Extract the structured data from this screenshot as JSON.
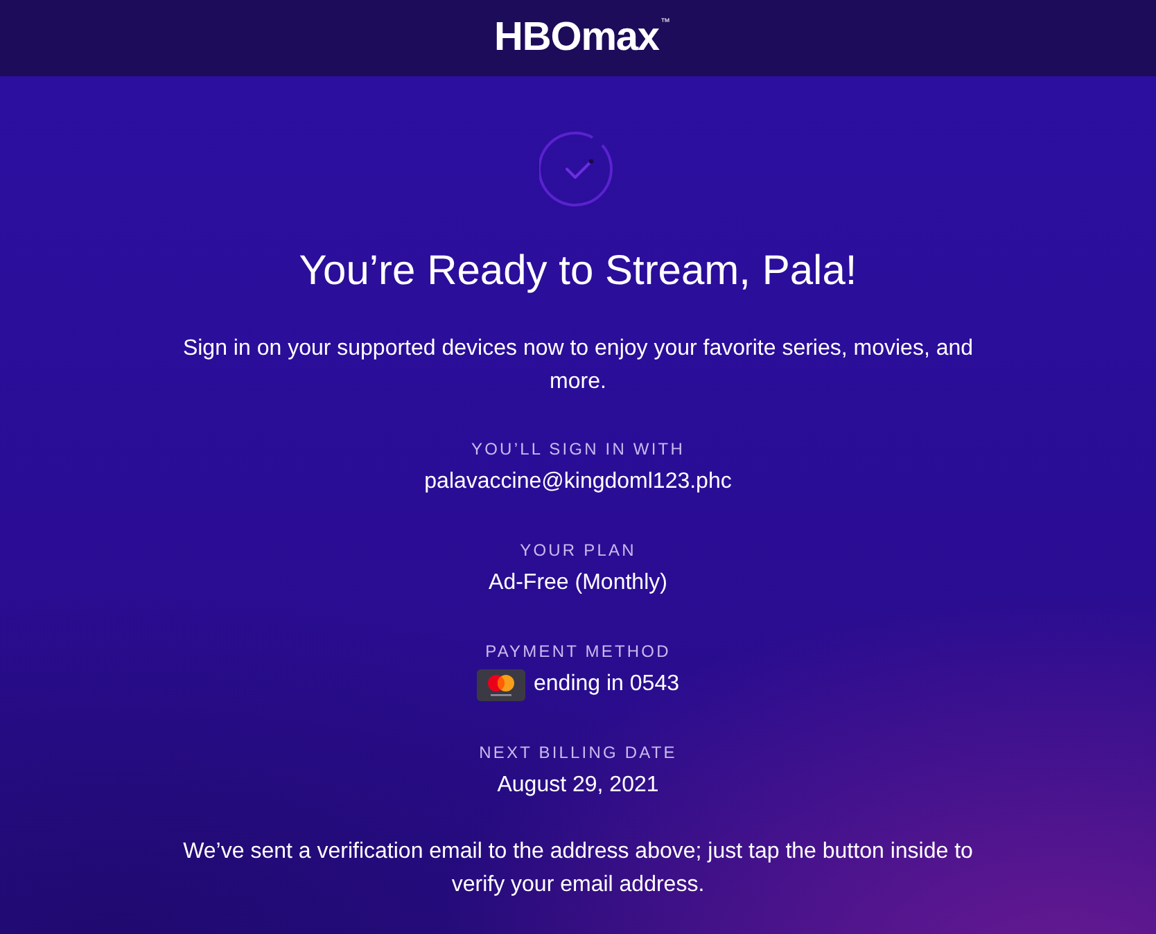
{
  "header": {
    "logo": "HBOmax",
    "trademark": "™"
  },
  "title": "You’re Ready to Stream, Pala!",
  "intro": "Sign in on your supported devices now to enjoy your favorite series, movies, and more.",
  "details": [
    {
      "kind": "text",
      "label": "YOU’LL SIGN IN WITH",
      "value": "palavaccine@kingdoml123.phc"
    },
    {
      "kind": "text",
      "label": "YOUR PLAN",
      "value": "Ad-Free (Monthly)"
    },
    {
      "kind": "card",
      "label": "PAYMENT METHOD",
      "value": "ending in 0543"
    },
    {
      "kind": "text",
      "label": "NEXT BILLING DATE",
      "value": "August 29, 2021"
    }
  ],
  "note": "We’ve sent a verification email to the address above; just tap the button inside to verify your email address."
}
